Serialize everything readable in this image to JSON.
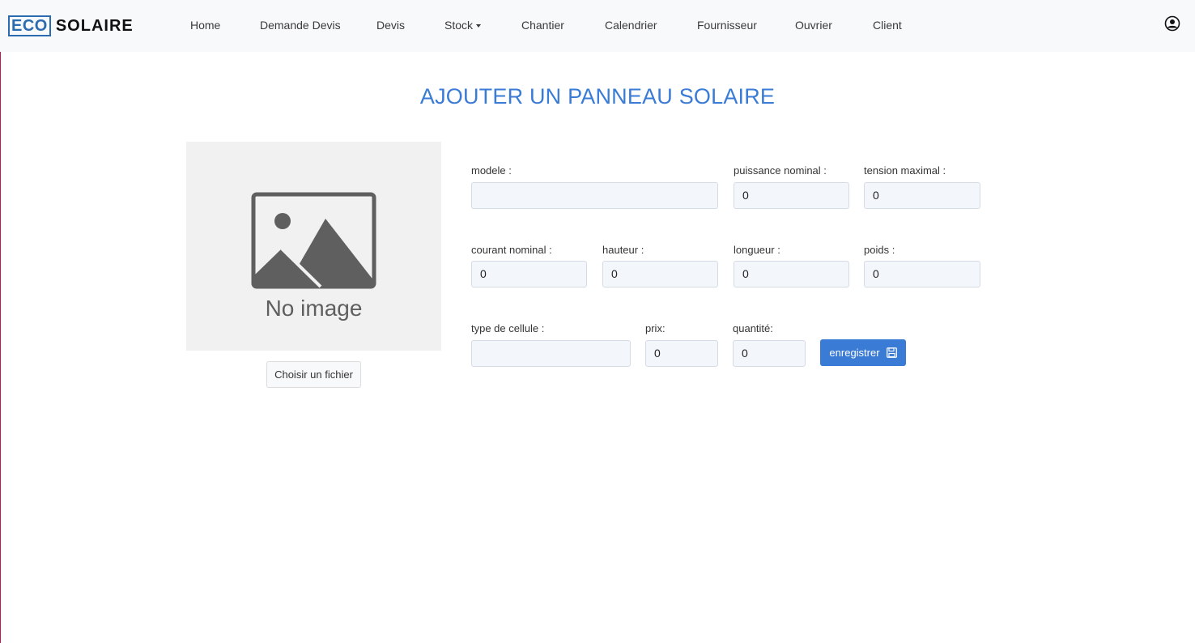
{
  "brand": {
    "eco": "ECO",
    "solaire": "SOLAIRE"
  },
  "nav": {
    "home": "Home",
    "demande_devis": "Demande Devis",
    "devis": "Devis",
    "stock": "Stock",
    "chantier": "Chantier",
    "calendrier": "Calendrier",
    "fournisseur": "Fournisseur",
    "ouvrier": "Ouvrier",
    "client": "Client"
  },
  "page": {
    "title": "AJOUTER UN PANNEAU SOLAIRE"
  },
  "image": {
    "placeholder_text": "No image",
    "choose_file_label": "Choisir un fichier"
  },
  "form": {
    "modele": {
      "label": "modele :",
      "value": ""
    },
    "puissance_nominal": {
      "label": "puissance nominal :",
      "value": "0"
    },
    "tension_maximal": {
      "label": "tension maximal :",
      "value": "0"
    },
    "courant_nominal": {
      "label": "courant nominal :",
      "value": "0"
    },
    "hauteur": {
      "label": "hauteur :",
      "value": "0"
    },
    "longueur": {
      "label": "longueur :",
      "value": "0"
    },
    "poids": {
      "label": "poids :",
      "value": "0"
    },
    "type_de_cellule": {
      "label": "type de cellule :",
      "value": ""
    },
    "prix": {
      "label": "prix:",
      "value": "0"
    },
    "quantite": {
      "label": "quantité:",
      "value": "0"
    },
    "save_label": "enregistrer"
  },
  "icons": {
    "user": "user-circle-icon",
    "save": "floppy-disk-icon",
    "caret": "caret-down-icon",
    "image_placeholder": "image-placeholder-icon"
  },
  "colors": {
    "accent": "#3a7bd5",
    "navbar_bg": "#f8f9fa",
    "brand_blue": "#2b6cb0"
  }
}
